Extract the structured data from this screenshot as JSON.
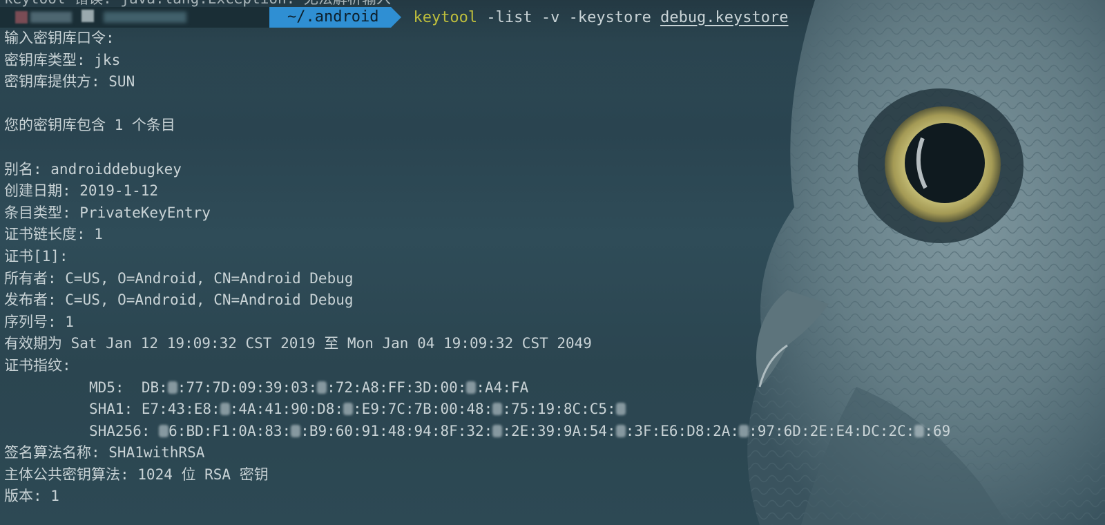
{
  "top_partial_line": "keytool 错误: java.lang.Exception: 无法解析输入",
  "prompt": {
    "directory": "~/.android",
    "command_name": "keytool",
    "command_args": " -list -v -keystore ",
    "command_file": "debug.keystore"
  },
  "output": {
    "password_prompt": "输入密钥库口令:",
    "keystore_type": "密钥库类型: jks",
    "keystore_provider": "密钥库提供方: SUN",
    "entries_count": "您的密钥库包含 1 个条目",
    "alias": "别名: androiddebugkey",
    "created": "创建日期: 2019-1-12",
    "entry_type": "条目类型: PrivateKeyEntry",
    "chain_length": "证书链长度: 1",
    "cert_index": "证书[1]:",
    "owner": "所有者: C=US, O=Android, CN=Android Debug",
    "issuer": "发布者: C=US, O=Android, CN=Android Debug",
    "serial": "序列号: 1",
    "validity": "有效期为 Sat Jan 12 19:09:32 CST 2019 至 Mon Jan 04 19:09:32 CST 2049",
    "fingerprints_header": "证书指纹:",
    "md5_a": "MD5:  DB:",
    "md5_b": ":77:7D:09:39:03:",
    "md5_c": ":72:A8:FF:3D:00:",
    "md5_d": ":A4:FA",
    "sha1_a": "SHA1: E7:43:E8:",
    "sha1_b": ":4A:41:90:D8:",
    "sha1_c": ":E9:7C:7B:00:48:",
    "sha1_d": ":75:19:8C:C5:",
    "sha256_a": "SHA256: ",
    "sha256_b": "6:BD:F1:0A:83:",
    "sha256_c": ":B9:60:91:48:94:8F:32:",
    "sha256_d": ":2E:39:9A:54:",
    "sha256_e": ":3F:E6:D8:2A:",
    "sha256_f": ":97:6D:2E:E4:DC:2C:",
    "sha256_g": ":69",
    "sig_algorithm": "签名算法名称: SHA1withRSA",
    "public_key": "主体公共密钥算法: 1024 位 RSA 密钥",
    "version": "版本: 1"
  },
  "colors": {
    "background": "#2b4651",
    "text": "#c9d3d6",
    "command": "#bdbd3c",
    "dir_segment": "#2f8fd3"
  }
}
